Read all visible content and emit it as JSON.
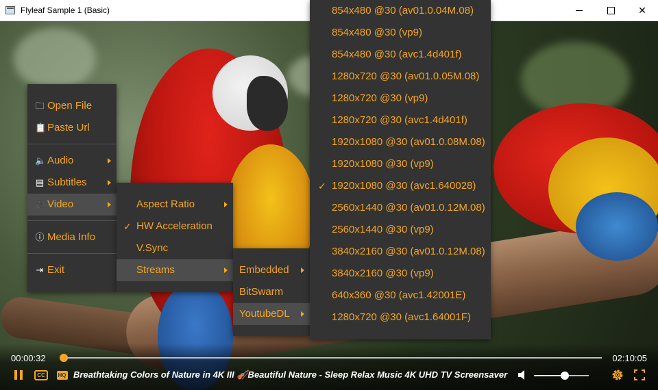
{
  "window": {
    "title": "Flyleaf Sample 1 (Basic)",
    "controls": {
      "minimize_icon": "minimize-icon",
      "maximize_icon": "maximize-icon",
      "close_glyph": "✕"
    }
  },
  "main_menu": {
    "items": [
      {
        "label": "Open File",
        "icon": "folder-icon",
        "glyph": "🗀"
      },
      {
        "label": "Paste Url",
        "icon": "clipboard-icon",
        "glyph": "📋"
      },
      {
        "label": "Audio",
        "icon": "speaker-icon",
        "glyph": "🔈",
        "submenu": true
      },
      {
        "label": "Subtitles",
        "icon": "subtitles-icon",
        "glyph": "▤",
        "submenu": true
      },
      {
        "label": "Video",
        "icon": "video-camera-icon",
        "glyph": "🎥",
        "submenu": true,
        "active": true
      },
      {
        "label": "Media Info",
        "icon": "info-icon",
        "glyph": "ⓘ"
      },
      {
        "label": "Exit",
        "icon": "exit-icon",
        "glyph": "⇥"
      }
    ]
  },
  "video_menu": {
    "items": [
      {
        "label": "Aspect Ratio",
        "submenu": true
      },
      {
        "label": "HW Acceleration",
        "checked": true
      },
      {
        "label": "V.Sync"
      },
      {
        "label": "Streams",
        "submenu": true,
        "active": true
      }
    ]
  },
  "streams_menu": {
    "items": [
      {
        "label": "Embedded",
        "submenu": true
      },
      {
        "label": "BitSwarm"
      },
      {
        "label": "YoutubeDL",
        "submenu": true,
        "active": true
      }
    ]
  },
  "youtubedl_menu": {
    "items": [
      {
        "label": "854x480 @30 (av01.0.04M.08)"
      },
      {
        "label": "854x480 @30 (vp9)"
      },
      {
        "label": "854x480 @30 (avc1.4d401f)"
      },
      {
        "label": "1280x720 @30 (av01.0.05M.08)"
      },
      {
        "label": "1280x720 @30 (vp9)"
      },
      {
        "label": "1280x720 @30 (avc1.4d401f)"
      },
      {
        "label": "1920x1080 @30 (av01.0.08M.08)"
      },
      {
        "label": "1920x1080 @30 (vp9)"
      },
      {
        "label": "1920x1080 @30 (avc1.640028)",
        "checked": true
      },
      {
        "label": "2560x1440 @30 (av01.0.12M.08)"
      },
      {
        "label": "2560x1440 @30 (vp9)"
      },
      {
        "label": "3840x2160 @30 (av01.0.12M.08)"
      },
      {
        "label": "3840x2160 @30 (vp9)"
      },
      {
        "label": "640x360 @30 (avc1.42001E)"
      },
      {
        "label": "1280x720 @30 (avc1.64001F)"
      }
    ]
  },
  "player": {
    "current_time": "00:00:32",
    "total_time": "02:10:05",
    "seek_fraction": 0.004,
    "volume_fraction": 0.56,
    "media_title": "Breathtaking Colors of Nature in 4K III 🎻Beautiful Nature - Sleep Relax Music 4K UHD TV Screensaver",
    "cc_label": "CC",
    "hq_label": "HQ"
  },
  "colors": {
    "accent": "#f5a623",
    "menu_bg": "#333333",
    "menu_active_bg": "#4d4d4d"
  }
}
